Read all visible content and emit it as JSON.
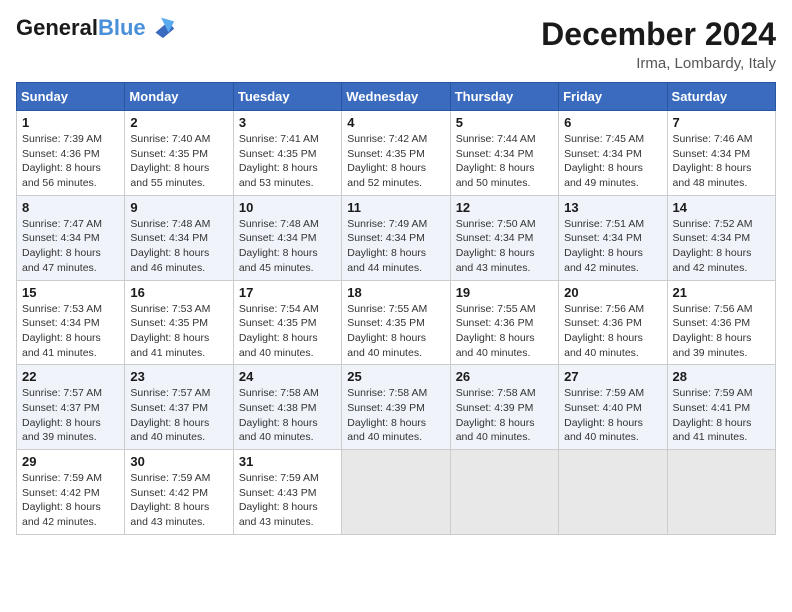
{
  "logo": {
    "line1": "General",
    "line2": "Blue"
  },
  "title": "December 2024",
  "subtitle": "Irma, Lombardy, Italy",
  "days_of_week": [
    "Sunday",
    "Monday",
    "Tuesday",
    "Wednesday",
    "Thursday",
    "Friday",
    "Saturday"
  ],
  "weeks": [
    [
      {
        "day": 1,
        "sunrise": "7:39 AM",
        "sunset": "4:36 PM",
        "daylight": "8 hours and 56 minutes."
      },
      {
        "day": 2,
        "sunrise": "7:40 AM",
        "sunset": "4:35 PM",
        "daylight": "8 hours and 55 minutes."
      },
      {
        "day": 3,
        "sunrise": "7:41 AM",
        "sunset": "4:35 PM",
        "daylight": "8 hours and 53 minutes."
      },
      {
        "day": 4,
        "sunrise": "7:42 AM",
        "sunset": "4:35 PM",
        "daylight": "8 hours and 52 minutes."
      },
      {
        "day": 5,
        "sunrise": "7:44 AM",
        "sunset": "4:34 PM",
        "daylight": "8 hours and 50 minutes."
      },
      {
        "day": 6,
        "sunrise": "7:45 AM",
        "sunset": "4:34 PM",
        "daylight": "8 hours and 49 minutes."
      },
      {
        "day": 7,
        "sunrise": "7:46 AM",
        "sunset": "4:34 PM",
        "daylight": "8 hours and 48 minutes."
      }
    ],
    [
      {
        "day": 8,
        "sunrise": "7:47 AM",
        "sunset": "4:34 PM",
        "daylight": "8 hours and 47 minutes."
      },
      {
        "day": 9,
        "sunrise": "7:48 AM",
        "sunset": "4:34 PM",
        "daylight": "8 hours and 46 minutes."
      },
      {
        "day": 10,
        "sunrise": "7:48 AM",
        "sunset": "4:34 PM",
        "daylight": "8 hours and 45 minutes."
      },
      {
        "day": 11,
        "sunrise": "7:49 AM",
        "sunset": "4:34 PM",
        "daylight": "8 hours and 44 minutes."
      },
      {
        "day": 12,
        "sunrise": "7:50 AM",
        "sunset": "4:34 PM",
        "daylight": "8 hours and 43 minutes."
      },
      {
        "day": 13,
        "sunrise": "7:51 AM",
        "sunset": "4:34 PM",
        "daylight": "8 hours and 42 minutes."
      },
      {
        "day": 14,
        "sunrise": "7:52 AM",
        "sunset": "4:34 PM",
        "daylight": "8 hours and 42 minutes."
      }
    ],
    [
      {
        "day": 15,
        "sunrise": "7:53 AM",
        "sunset": "4:34 PM",
        "daylight": "8 hours and 41 minutes."
      },
      {
        "day": 16,
        "sunrise": "7:53 AM",
        "sunset": "4:35 PM",
        "daylight": "8 hours and 41 minutes."
      },
      {
        "day": 17,
        "sunrise": "7:54 AM",
        "sunset": "4:35 PM",
        "daylight": "8 hours and 40 minutes."
      },
      {
        "day": 18,
        "sunrise": "7:55 AM",
        "sunset": "4:35 PM",
        "daylight": "8 hours and 40 minutes."
      },
      {
        "day": 19,
        "sunrise": "7:55 AM",
        "sunset": "4:36 PM",
        "daylight": "8 hours and 40 minutes."
      },
      {
        "day": 20,
        "sunrise": "7:56 AM",
        "sunset": "4:36 PM",
        "daylight": "8 hours and 40 minutes."
      },
      {
        "day": 21,
        "sunrise": "7:56 AM",
        "sunset": "4:36 PM",
        "daylight": "8 hours and 39 minutes."
      }
    ],
    [
      {
        "day": 22,
        "sunrise": "7:57 AM",
        "sunset": "4:37 PM",
        "daylight": "8 hours and 39 minutes."
      },
      {
        "day": 23,
        "sunrise": "7:57 AM",
        "sunset": "4:37 PM",
        "daylight": "8 hours and 40 minutes."
      },
      {
        "day": 24,
        "sunrise": "7:58 AM",
        "sunset": "4:38 PM",
        "daylight": "8 hours and 40 minutes."
      },
      {
        "day": 25,
        "sunrise": "7:58 AM",
        "sunset": "4:39 PM",
        "daylight": "8 hours and 40 minutes."
      },
      {
        "day": 26,
        "sunrise": "7:58 AM",
        "sunset": "4:39 PM",
        "daylight": "8 hours and 40 minutes."
      },
      {
        "day": 27,
        "sunrise": "7:59 AM",
        "sunset": "4:40 PM",
        "daylight": "8 hours and 40 minutes."
      },
      {
        "day": 28,
        "sunrise": "7:59 AM",
        "sunset": "4:41 PM",
        "daylight": "8 hours and 41 minutes."
      }
    ],
    [
      {
        "day": 29,
        "sunrise": "7:59 AM",
        "sunset": "4:42 PM",
        "daylight": "8 hours and 42 minutes."
      },
      {
        "day": 30,
        "sunrise": "7:59 AM",
        "sunset": "4:42 PM",
        "daylight": "8 hours and 43 minutes."
      },
      {
        "day": 31,
        "sunrise": "7:59 AM",
        "sunset": "4:43 PM",
        "daylight": "8 hours and 43 minutes."
      },
      null,
      null,
      null,
      null
    ]
  ]
}
